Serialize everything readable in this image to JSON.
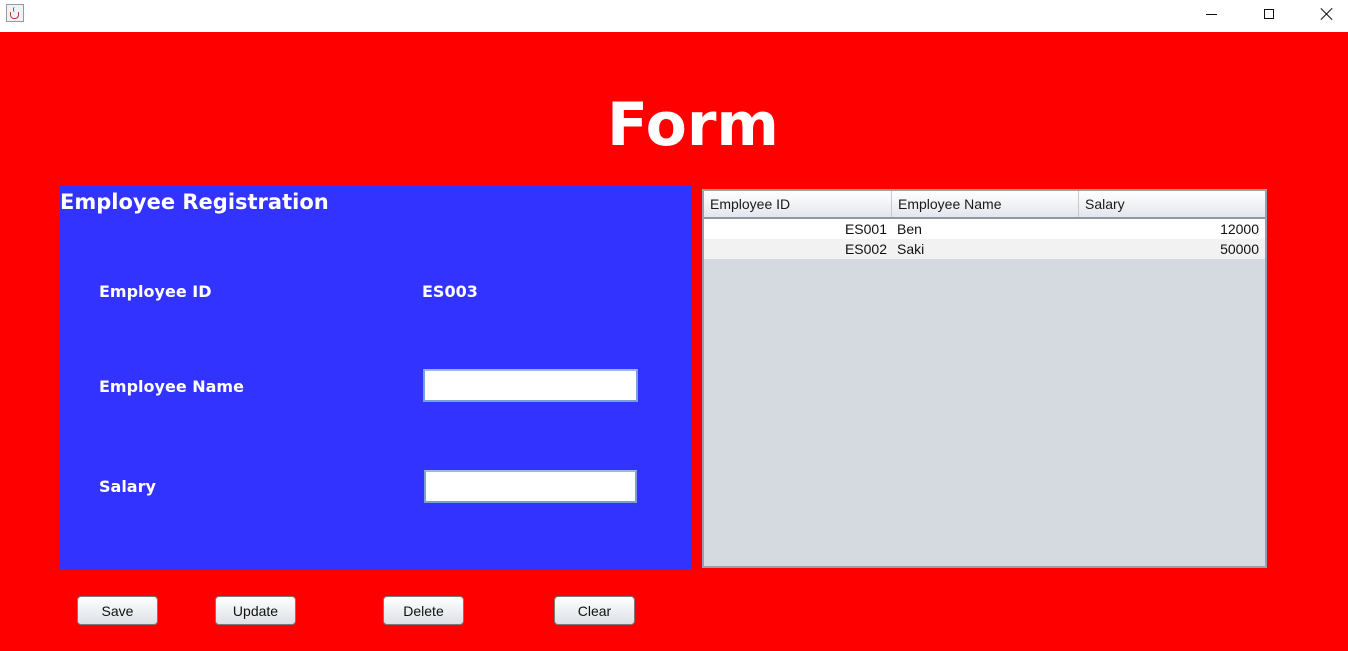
{
  "window": {
    "icon": "java-cup-icon"
  },
  "form": {
    "title": "Form"
  },
  "registration": {
    "heading": "Employee Registration",
    "id_label": "Employee ID",
    "id_value": "ES003",
    "name_label": "Employee Name",
    "name_value": "",
    "salary_label": "Salary",
    "salary_value": ""
  },
  "table": {
    "columns": [
      "Employee ID",
      "Employee Name",
      "Salary"
    ],
    "rows": [
      [
        "ES001",
        "Ben",
        "12000"
      ],
      [
        "ES002",
        "Saki",
        "50000"
      ]
    ]
  },
  "buttons": {
    "save": "Save",
    "update": "Update",
    "delete": "Delete",
    "clear": "Clear"
  },
  "colors": {
    "background": "#ff0000",
    "panel": "#3333ff",
    "table_empty": "#d5d9e0",
    "text": "#ffffff"
  }
}
